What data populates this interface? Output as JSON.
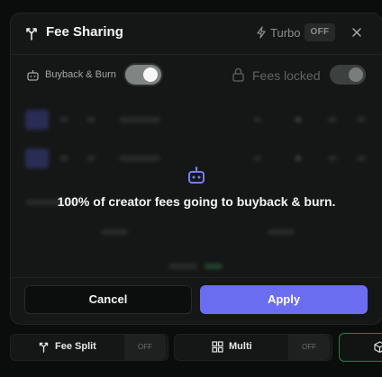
{
  "modal": {
    "title": "Fee Sharing",
    "turbo": {
      "label": "Turbo",
      "badge": "OFF"
    },
    "buyback": {
      "label": "Buyback & Burn",
      "enabled": true
    },
    "fees_locked": {
      "label": "Fees locked",
      "enabled": false
    },
    "message": "100% of creator fees going to buyback & burn.",
    "cancel_label": "Cancel",
    "apply_label": "Apply"
  },
  "bottom_bar": {
    "fee_split": {
      "label": "Fee Split",
      "badge": "OFF"
    },
    "multi": {
      "label": "Multi",
      "badge": "OFF"
    }
  },
  "colors": {
    "accent": "#6b6df0",
    "background": "#0b0d0c",
    "panel": "#151716",
    "green_border": "#2e7d4f"
  },
  "icons": {
    "title": "split-arrows-icon",
    "turbo": "lightning-icon",
    "close": "close-icon",
    "buyback": "robot-icon",
    "locked": "lock-icon",
    "message": "robot-icon",
    "fee_split": "split-arrows-icon",
    "multi": "grid-icon",
    "extra": "cube-icon"
  }
}
